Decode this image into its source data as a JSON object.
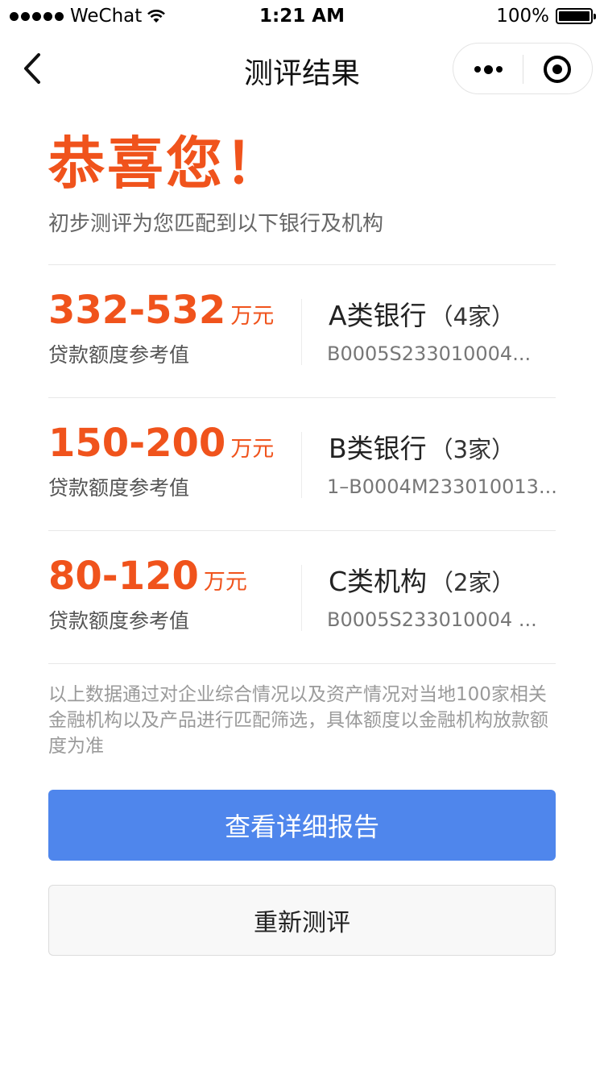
{
  "status_bar": {
    "carrier": "WeChat",
    "time": "1:21 AM",
    "battery": "100%"
  },
  "nav": {
    "title": "测评结果",
    "icons": [
      "chevron-left-icon",
      "more-dots-icon",
      "close-target-icon"
    ]
  },
  "hero": {
    "title": "恭喜您！",
    "subtitle": "初步测评为您匹配到以下银行及机构"
  },
  "results": [
    {
      "amount": "332-532",
      "unit": "万元",
      "label": "贷款额度参考值",
      "bank": "A类银行",
      "count": "（4家）",
      "code": "B0005S233010004..."
    },
    {
      "amount": "150-200",
      "unit": "万元",
      "label": "贷款额度参考值",
      "bank": "B类银行",
      "count": "（3家）",
      "code": "1–B0004M233010013..."
    },
    {
      "amount": "80-120",
      "unit": "万元",
      "label": "贷款额度参考值",
      "bank": "C类机构",
      "count": "（2家）",
      "code": "B0005S233010004 ..."
    }
  ],
  "note": "以上数据通过对企业综合情况以及资产情况对当地100家相关金融机构以及产品进行匹配筛选，具体额度以金融机构放款额度为准",
  "buttons": {
    "primary": "查看详细报告",
    "secondary": "重新测评"
  },
  "colors": {
    "accent": "#f0531c",
    "primary_button": "#4f86ec"
  }
}
